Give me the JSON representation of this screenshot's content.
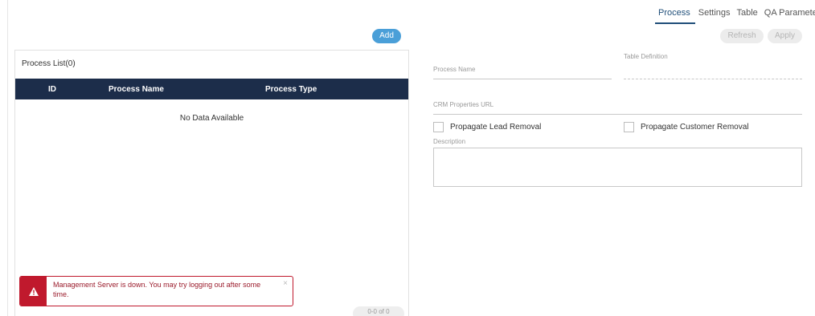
{
  "tabs": [
    {
      "label": "Process",
      "active": true
    },
    {
      "label": "Settings",
      "active": false
    },
    {
      "label": "Table",
      "active": false
    },
    {
      "label": "QA Parameters",
      "active": false
    }
  ],
  "list": {
    "add_label": "Add",
    "title": "Process List(0)",
    "columns": [
      "ID",
      "Process Name",
      "Process Type"
    ],
    "empty_text": "No Data Available",
    "pager_text": "0-0 of 0"
  },
  "form": {
    "refresh_label": "Refresh",
    "apply_label": "Apply",
    "process_name_label": "Process Name",
    "table_definition_label": "Table Definition",
    "crm_url_label": "CRM Properties URL",
    "propagate_lead_label": "Propagate Lead Removal",
    "propagate_customer_label": "Propagate Customer Removal",
    "description_label": "Description"
  },
  "toast": {
    "message": "Management Server is down. You may try logging out after some time.",
    "close_symbol": "×"
  },
  "colors": {
    "accent": "#1f4e79",
    "header_bg": "#1c2d4a",
    "add_button": "#4a9fd8",
    "error": "#c0192d"
  }
}
